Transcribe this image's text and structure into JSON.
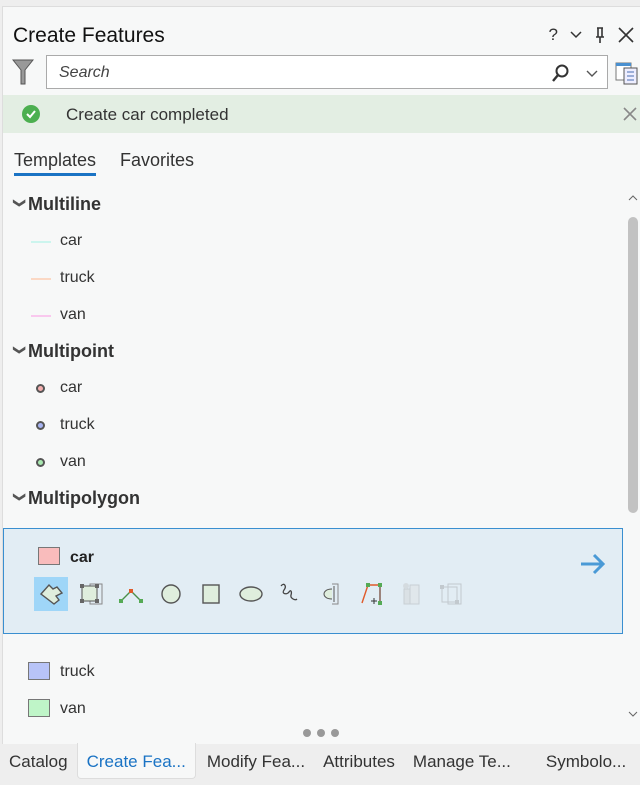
{
  "header": {
    "title": "Create Features",
    "help": "?"
  },
  "search": {
    "placeholder": "Search"
  },
  "banner": {
    "message": "Create car completed"
  },
  "tabs": [
    {
      "label": "Templates"
    },
    {
      "label": "Favorites"
    }
  ],
  "groups": [
    {
      "name": "Multiline",
      "items": [
        {
          "label": "car",
          "color": "#ccf5ee"
        },
        {
          "label": "truck",
          "color": "#fbd8c4"
        },
        {
          "label": "van",
          "color": "#f9c8ee"
        }
      ]
    },
    {
      "name": "Multipoint",
      "items": [
        {
          "label": "car",
          "color": "#f4b0b0"
        },
        {
          "label": "truck",
          "color": "#a8b4f2"
        },
        {
          "label": "van",
          "color": "#a8e8b0"
        }
      ]
    },
    {
      "name": "Multipolygon",
      "items": [
        {
          "label": "car",
          "color": "#f9bcbc"
        },
        {
          "label": "truck",
          "color": "#b8c4f8"
        },
        {
          "label": "van",
          "color": "#bff5c8"
        }
      ]
    }
  ],
  "bottom_tabs": [
    {
      "label": "Catalog"
    },
    {
      "label": "Create Fea..."
    },
    {
      "label": "Modify Fea..."
    },
    {
      "label": "Attributes"
    },
    {
      "label": "Manage Te..."
    },
    {
      "label": "Symbolo..."
    }
  ]
}
